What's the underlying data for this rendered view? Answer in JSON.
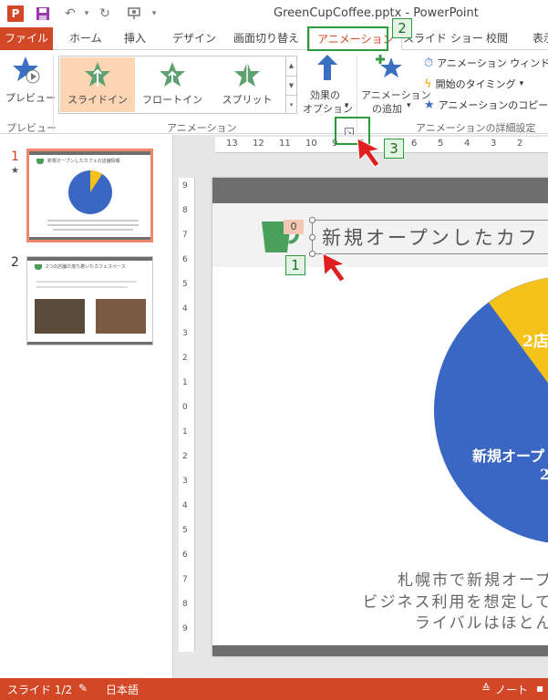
{
  "window": {
    "title": "GreenCupCoffee.pptx - PowerPoint",
    "app_logo": "P",
    "accent_color": "#d24726"
  },
  "quick_access": {
    "icons": [
      "powerpoint-logo-icon",
      "save-icon",
      "undo-icon",
      "redo-icon",
      "present-from-start-icon"
    ]
  },
  "tabs": [
    {
      "label": "ファイル"
    },
    {
      "label": "ホーム"
    },
    {
      "label": "挿入"
    },
    {
      "label": "デザイン"
    },
    {
      "label": "画面切り替え"
    },
    {
      "label": "アニメーション"
    },
    {
      "label": "スライド ショー"
    },
    {
      "label": "校閲"
    },
    {
      "label": "表示"
    }
  ],
  "ribbon": {
    "preview": {
      "label": "プレビュー",
      "group_label": "プレビュー"
    },
    "gallery": {
      "items": [
        {
          "label": "スライドイン",
          "selected": true
        },
        {
          "label": "フロートイン",
          "selected": false
        },
        {
          "label": "スプリット",
          "selected": false
        }
      ],
      "group_label": "アニメーション"
    },
    "effect_options": {
      "line1": "効果の",
      "line2": "オプション"
    },
    "add_animation": {
      "line1": "アニメーション",
      "line2": "の追加"
    },
    "advanced": {
      "pane": "アニメーション ウィンドウ",
      "timing": "開始のタイミング",
      "painter": "アニメーションのコピー/貼り付け",
      "group_label": "アニメーションの詳細設定"
    }
  },
  "callouts": [
    "1",
    "2",
    "3"
  ],
  "ruler": {
    "h_ticks": [
      "13",
      "12",
      "11",
      "10",
      "9",
      "8",
      "7",
      "6",
      "5",
      "4",
      "3",
      "2"
    ],
    "v_ticks": [
      "9",
      "8",
      "7",
      "6",
      "5",
      "4",
      "3",
      "2",
      "1",
      "0",
      "1",
      "2",
      "3",
      "4",
      "5",
      "6",
      "7",
      "8",
      "9"
    ]
  },
  "thumbnails": [
    {
      "number": "1",
      "star": "★",
      "title": "新規オープンしたカフェの店舗情報"
    },
    {
      "number": "2",
      "title": "2つの店舗の落ち着いたカフェスペース"
    }
  ],
  "slide": {
    "title": "新規オープンしたカフ",
    "animation_tag": "0",
    "pie_label_1": "2店",
    "pie_label_2": "新規オープ",
    "pie_label_3": "2",
    "body_lines": [
      "札幌市で新規オープン",
      "ビジネス利用を想定してい",
      "ライバルはほとんど"
    ],
    "chart_colors": {
      "blue": "#3a66c4",
      "yellow": "#f4c21b"
    }
  },
  "status": {
    "slide_count": "スライド 1/2",
    "language": "日本語",
    "notes": "ノート"
  }
}
